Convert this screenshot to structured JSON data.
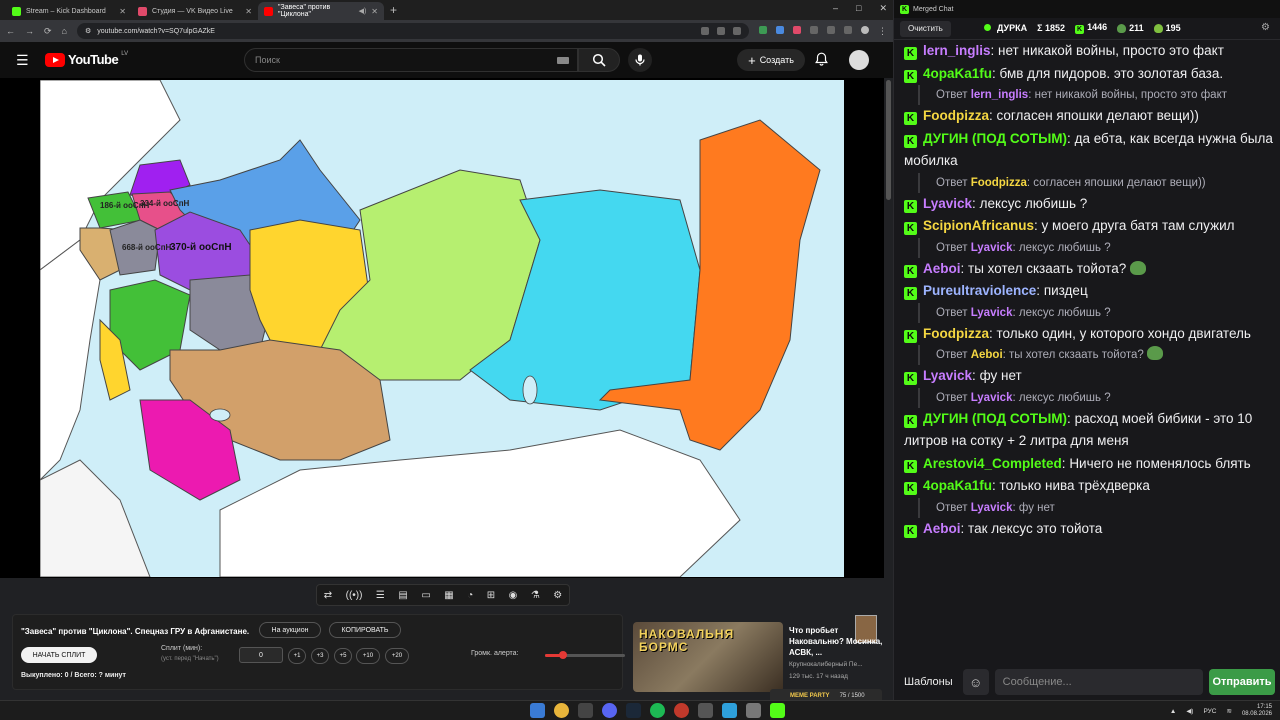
{
  "browser": {
    "tabs": [
      {
        "label": "Stream – Kick Dashboard",
        "color": "#53fc18"
      },
      {
        "label": "Студия — VK Видео Live",
        "color": "#e04a6a"
      },
      {
        "label": "\"Завеса\" против \"Циклона\"",
        "color": "#ff0000"
      }
    ],
    "url": "youtube.com/watch?v=SQ7ulpGAZkE",
    "window_controls": [
      "–",
      "□",
      "✕"
    ]
  },
  "youtube": {
    "logo_text": "YouTube",
    "region": "LV",
    "search_placeholder": "Поиск",
    "create_label": "Создать"
  },
  "map": {
    "labels": [
      {
        "text": "186-й ооСпН"
      },
      {
        "text": "334-й ооСпН"
      },
      {
        "text": "668-й ооСпН"
      },
      {
        "text": "370-й ооСпН"
      }
    ],
    "region_colors": {
      "purple": "#a020f0",
      "violet": "#9b4de0",
      "green": "#43c038",
      "pink": "#e7508a",
      "blue": "#5aa0e8",
      "yellow": "#ffd52e",
      "lightgreen": "#b6ef70",
      "cyan": "#44d8f0",
      "orange": "#ff7a1f",
      "tan": "#d2a06a",
      "magenta": "#ec1ab0",
      "grey": "#8a8a9a",
      "water": "#cfeef8"
    }
  },
  "player_controls": [
    "loop-icon",
    "broadcast-icon",
    "playlist-icon",
    "clapper-icon",
    "frame-icon",
    "subtitles-icon",
    "speed-icon",
    "add-icon",
    "screenshot-icon",
    "flask-icon",
    "gear-icon"
  ],
  "panel": {
    "title": "\"Завеса\" против \"Циклона\". Спецназ ГРУ в Афганистане.",
    "auction_label": "На аукцион",
    "copy_label": "КОПИРОВАТЬ",
    "start_split_label": "НАЧАТЬ СПЛИТ",
    "split_label": "Сплит (мин):",
    "split_sub": "(уст. перед \"Начать\")",
    "split_value": "0",
    "increments": [
      "+1",
      "+3",
      "+5",
      "+10",
      "+20"
    ],
    "volume_label": "Громк. алерта:",
    "volume_level": 0.22,
    "bought_text": "Выкуплено: 0 / Всего: ? минут"
  },
  "recommendation": {
    "thumb_text": "НАКОВАЛЬНЯ БОРМС",
    "title": "Что пробьет Наковальню? Мосинка, АСВК, ...",
    "channel": "Крупнокалиберный Пе...",
    "meta": "129 тыс.  17 ч назад"
  },
  "overlay_widget": {
    "label": "MEME PARTY",
    "count": "75 / 1500"
  },
  "chat": {
    "window_title": "Merged Chat",
    "clear_label": "Очистить",
    "channel": "ДУРКА",
    "sum": "Σ 1852",
    "kick_count": "1446",
    "other_count": "211",
    "emote_count": "195",
    "messages": [
      {
        "nick": "lern_inglis",
        "color": "#c77dff",
        "text": "нет никакой войны, просто это факт"
      },
      {
        "nick": "4opaKa1fu",
        "color": "#53fc18",
        "text": "бмв для пидоров. это золотая база."
      },
      {
        "reply": true,
        "prefix": "Ответ",
        "nick": "lern_inglis",
        "color": "#c77dff",
        "text": "нет никакой войны, просто это факт"
      },
      {
        "nick": "Foodpizza",
        "color": "#f5d742",
        "text": "согласен япошки делают вещи))"
      },
      {
        "nick": "ДУГИН (ПОД СОТЫМ)",
        "color": "#53fc18",
        "text": "да ебта, как всегда нужна была мобилка"
      },
      {
        "reply": true,
        "prefix": "Ответ",
        "nick": "Foodpizza",
        "color": "#f5d742",
        "text": "согласен япошки делают вещи))"
      },
      {
        "nick": "Lyavick",
        "color": "#c77dff",
        "text": "лексус любишь ?"
      },
      {
        "nick": "ScipionAfricanus",
        "color": "#f5d742",
        "text": "у моего друга батя там служил"
      },
      {
        "reply": true,
        "prefix": "Ответ",
        "nick": "Lyavick",
        "color": "#c77dff",
        "text": "лексус любишь ?"
      },
      {
        "nick": "Aeboi",
        "color": "#c77dff",
        "text": "ты хотел скзаать тойота?",
        "emote": "pepe-emote"
      },
      {
        "nick": "Pureultraviolence",
        "color": "#9db4ff",
        "text": "пиздец"
      },
      {
        "reply": true,
        "prefix": "Ответ",
        "nick": "Lyavick",
        "color": "#c77dff",
        "text": "лексус любишь ?"
      },
      {
        "nick": "Foodpizza",
        "color": "#f5d742",
        "text": "только один, у которого хондо двигатель"
      },
      {
        "reply": true,
        "prefix": "Ответ",
        "nick": "Aeboi",
        "color": "#f5d742",
        "text": "ты хотел скзаать тойота?",
        "emote": "pepe-emote"
      },
      {
        "nick": "Lyavick",
        "color": "#c77dff",
        "text": "фу нет"
      },
      {
        "reply": true,
        "prefix": "Ответ",
        "nick": "Lyavick",
        "color": "#c77dff",
        "text": "лексус любишь ?"
      },
      {
        "nick": "ДУГИН (ПОД СОТЫМ)",
        "color": "#53fc18",
        "text": "расход моей бибики - это 10 литров на сотку + 2 литра для меня"
      },
      {
        "nick": "Arestovi4_Completed",
        "color": "#53fc18",
        "text": "Ничего не поменялось блять"
      },
      {
        "nick": "4opaKa1fu",
        "color": "#53fc18",
        "text": "только нива трёхдверка"
      },
      {
        "reply": true,
        "prefix": "Ответ",
        "nick": "Lyavick",
        "color": "#c77dff",
        "text": "фу нет"
      },
      {
        "nick": "Aeboi",
        "color": "#c77dff",
        "text": "так лексус это тойота"
      }
    ],
    "templates_label": "Шаблоны",
    "input_placeholder": "Сообщение...",
    "send_label": "Отправить"
  },
  "taskbar": {
    "lang": "РУС",
    "time": "17:15",
    "date": "08.08.2026"
  }
}
